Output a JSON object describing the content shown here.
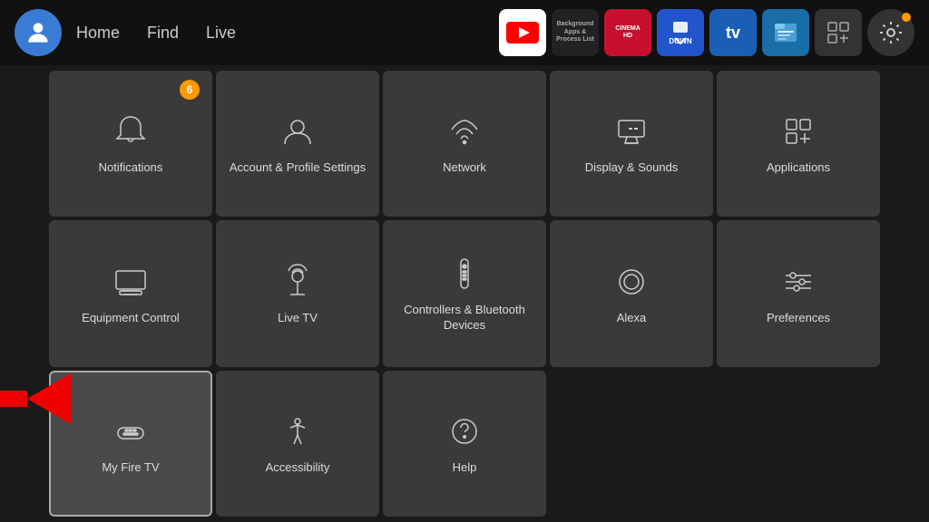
{
  "nav": {
    "links": [
      "Home",
      "Find",
      "Live"
    ],
    "apps": [
      {
        "name": "YouTube",
        "type": "youtube"
      },
      {
        "name": "Background Apps & Process List",
        "type": "bg"
      },
      {
        "name": "Cinema HD",
        "type": "cinema"
      },
      {
        "name": "Downloader",
        "type": "tv"
      },
      {
        "name": "TV",
        "type": "tvsmall"
      },
      {
        "name": "File Commander",
        "type": "files"
      },
      {
        "name": "App Grid",
        "type": "grid"
      }
    ],
    "settings_label": "Settings"
  },
  "grid": {
    "items": [
      {
        "id": "notifications",
        "label": "Notifications",
        "badge": "6",
        "icon": "bell"
      },
      {
        "id": "account",
        "label": "Account & Profile Settings",
        "badge": null,
        "icon": "user"
      },
      {
        "id": "network",
        "label": "Network",
        "badge": null,
        "icon": "wifi"
      },
      {
        "id": "display-sounds",
        "label": "Display & Sounds",
        "badge": null,
        "icon": "display"
      },
      {
        "id": "applications",
        "label": "Applications",
        "badge": null,
        "icon": "apps"
      },
      {
        "id": "equipment",
        "label": "Equipment Control",
        "badge": null,
        "icon": "monitor"
      },
      {
        "id": "live-tv",
        "label": "Live TV",
        "badge": null,
        "icon": "antenna"
      },
      {
        "id": "controllers",
        "label": "Controllers & Bluetooth Devices",
        "badge": null,
        "icon": "remote"
      },
      {
        "id": "alexa",
        "label": "Alexa",
        "badge": null,
        "icon": "alexa"
      },
      {
        "id": "preferences",
        "label": "Preferences",
        "badge": null,
        "icon": "sliders"
      },
      {
        "id": "my-fire-tv",
        "label": "My Fire TV",
        "badge": null,
        "icon": "firetv",
        "selected": true
      },
      {
        "id": "accessibility",
        "label": "Accessibility",
        "badge": null,
        "icon": "accessibility"
      },
      {
        "id": "help",
        "label": "Help",
        "badge": null,
        "icon": "help"
      },
      {
        "id": "empty1",
        "label": "",
        "badge": null,
        "icon": "none"
      },
      {
        "id": "empty2",
        "label": "",
        "badge": null,
        "icon": "none"
      }
    ]
  }
}
